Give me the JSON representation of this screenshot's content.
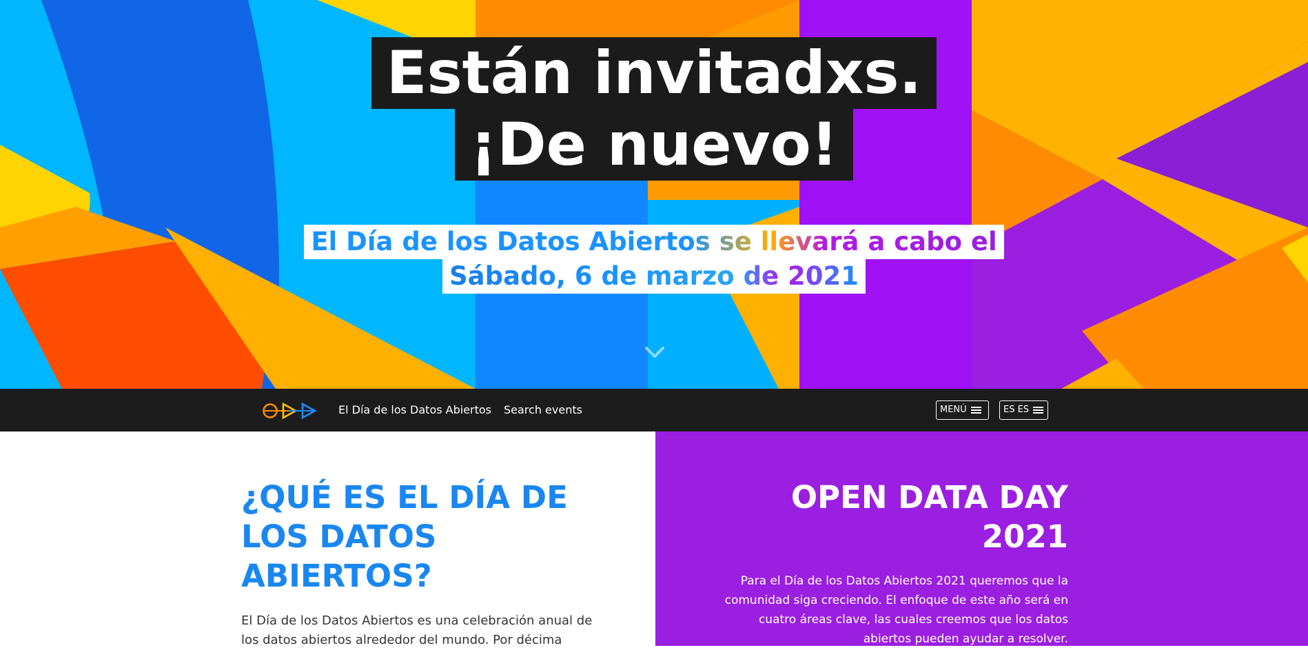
{
  "hero": {
    "title_line1": "Están invitadxs.",
    "title_line2": "¡De nuevo!",
    "subtitle_line1": "El Día de los Datos Abiertos se llevará a cabo el",
    "subtitle_line2": "Sábado, 6 de marzo de 2021",
    "scroll_icon": "chevron-down-icon"
  },
  "nav": {
    "logo_icon": "odd-logo-icon",
    "links": [
      {
        "label": "El Día de los Datos Abiertos"
      },
      {
        "label": "Search events"
      }
    ],
    "menu_label": "MENÚ",
    "lang_label": "ES ES",
    "menu_icon": "hamburger-icon"
  },
  "what_section": {
    "heading": "¿QUÉ ES EL DÍA DE LOS DATOS ABIERTOS?",
    "body": "El Día de los Datos Abiertos es una celebración anual de los datos abiertos alrededor del mundo. Por décima"
  },
  "odd_section": {
    "heading": "OPEN DATA DAY 2021",
    "body": "Para el Día de los Datos Abiertos 2021 queremos que la comunidad siga creciendo. El enfoque de este año será en cuatro áreas clave, las cuales creemos que los datos abiertos pueden ayudar a resolver."
  },
  "colors": {
    "nav_bg": "#1c1c1c",
    "heading_blue": "#1a87f0",
    "purple_panel": "#9b1fe0",
    "title_block": "#1b1b1b"
  }
}
